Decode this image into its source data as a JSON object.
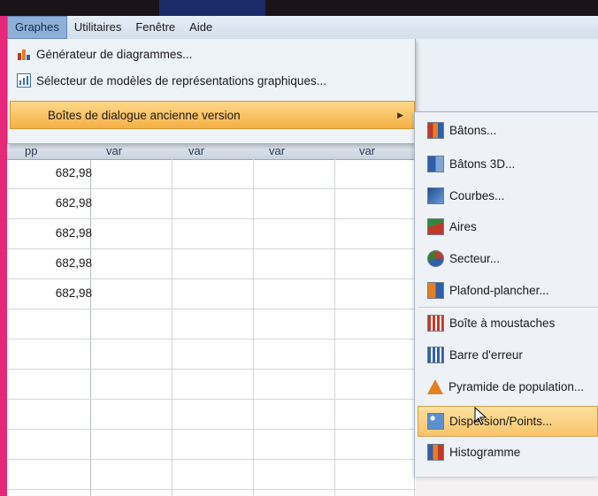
{
  "menubar": {
    "items": [
      {
        "label": "Graphes",
        "active": true
      },
      {
        "label": "Utilitaires"
      },
      {
        "label": "Fenêtre"
      },
      {
        "label": "Aide"
      }
    ]
  },
  "graph_menu": {
    "items": [
      {
        "label": "Générateur de diagrammes...",
        "icon": "chart-builder-icon"
      },
      {
        "label": "Sélecteur de modèles de représentations graphiques...",
        "icon": "template-chooser-icon"
      },
      {
        "label": "Boîtes de dialogue ancienne version",
        "icon": "none",
        "has_submenu": true,
        "highlighted": true
      }
    ]
  },
  "grid": {
    "headers": [
      "pp",
      "var",
      "var",
      "var",
      "var"
    ],
    "values": [
      "682,98",
      "682,98",
      "682,98",
      "682,98",
      "682,98"
    ]
  },
  "submenu": {
    "items": [
      {
        "label": "Bâtons...",
        "icon": "bar-chart-icon"
      },
      {
        "label": "Bâtons 3D...",
        "icon": "bar-3d-icon"
      },
      {
        "label": "Courbes...",
        "icon": "line-chart-icon"
      },
      {
        "label": "Aires",
        "icon": "area-chart-icon"
      },
      {
        "label": "Secteur...",
        "icon": "pie-chart-icon"
      },
      {
        "label": "Plafond-plancher...",
        "icon": "high-low-icon"
      },
      {
        "label": "Boîte à moustaches",
        "icon": "boxplot-icon"
      },
      {
        "label": "Barre d'erreur",
        "icon": "error-bar-icon"
      },
      {
        "label": "Pyramide de population...",
        "icon": "population-pyramid-icon"
      },
      {
        "label": "Dispersion/Points...",
        "icon": "scatter-icon",
        "highlighted": true
      },
      {
        "label": "Histogramme",
        "icon": "histogram-icon"
      }
    ]
  },
  "colors": {
    "highlight": "#f4b146",
    "frame": "#e7287a",
    "menubar": "#d3dfec"
  }
}
